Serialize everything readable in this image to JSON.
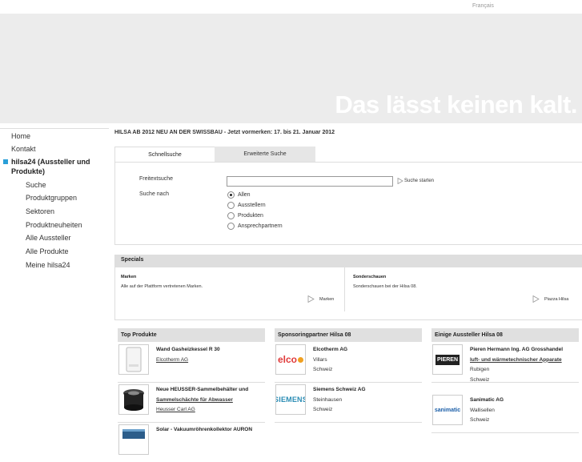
{
  "header": {
    "language": "Français",
    "claim": "Das lässt keinen kalt."
  },
  "sidebar": {
    "items": [
      {
        "label": "Home",
        "level": 1
      },
      {
        "label": "Kontakt",
        "level": 1
      },
      {
        "label": "hilsa24 (Aussteller und Produkte)",
        "level": 1,
        "active": true
      },
      {
        "label": "Suche",
        "level": 2
      },
      {
        "label": "Produktgruppen",
        "level": 2
      },
      {
        "label": "Sektoren",
        "level": 2
      },
      {
        "label": "Produktneuheiten",
        "level": 2
      },
      {
        "label": "Alle Aussteller",
        "level": 2
      },
      {
        "label": "Alle Produkte",
        "level": 2
      },
      {
        "label": "Meine hilsa24",
        "level": 2
      }
    ]
  },
  "announcement": "HILSA AB 2012 NEU AN DER SWISSBAU - Jetzt vormerken: 17. bis 21. Januar 2012",
  "search": {
    "tabs": [
      "Schnellsuche",
      "Erweiterte Suche"
    ],
    "freitext_label": "Freitextsuche",
    "freitext_value": "",
    "start_label": "Suche starten",
    "suche_nach_label": "Suche nach",
    "options": [
      "Allen",
      "Ausstellern",
      "Produkten",
      "Ansprechpartnern"
    ],
    "selected": "Allen"
  },
  "specials": {
    "title": "Specials",
    "columns": [
      {
        "title": "Marken",
        "text": "Alle auf der Plattform vertretenen Marken.",
        "link": "Marken"
      },
      {
        "title": "Sonderschauen",
        "text": "Sonderschauen bei der Hilsa 08.",
        "link": "Piazza Hilsa"
      }
    ]
  },
  "boxes": [
    {
      "title": "Top Produkte",
      "items": [
        {
          "name": "Wand Gasheizkessel R 30",
          "company": "Elcotherm AG",
          "icon": "boiler-icon"
        },
        {
          "name": "Neue HEUSSER-Sammelbehälter und",
          "name2": "Sammelschächte für Abwasser",
          "company": "Heusser Carl AG",
          "icon": "tank-icon"
        },
        {
          "name": "Solar - Vakuumröhrenkollektor AURON",
          "company": "",
          "icon": "solar-icon"
        }
      ]
    },
    {
      "title": "Sponsoringpartner Hilsa 08",
      "items": [
        {
          "name": "Elcotherm AG",
          "line2": "Villars",
          "line3": "Schweiz",
          "logo": "elco"
        },
        {
          "name": "Siemens Schweiz AG",
          "line2": "Steinhausen",
          "line3": "Schweiz",
          "logo": "SIEMENS"
        }
      ]
    },
    {
      "title": "Einige Aussteller Hilsa 08",
      "items": [
        {
          "name": "Pieren Hermann Ing. AG Grosshandel",
          "link": "luft- und wärmetechnischer Apparate",
          "line2": "Rubigen",
          "line3": "Schweiz",
          "logo": "PIEREN"
        },
        {
          "name": "Sanimatic AG",
          "line2": "Wallisellen",
          "line3": "Schweiz",
          "logo": "sanimatic"
        }
      ]
    }
  ],
  "colors": {
    "accent": "#2a9fd8",
    "banner": "#ececec",
    "elco_red": "#e03a3a",
    "siemens_teal": "#2a8cb4"
  }
}
